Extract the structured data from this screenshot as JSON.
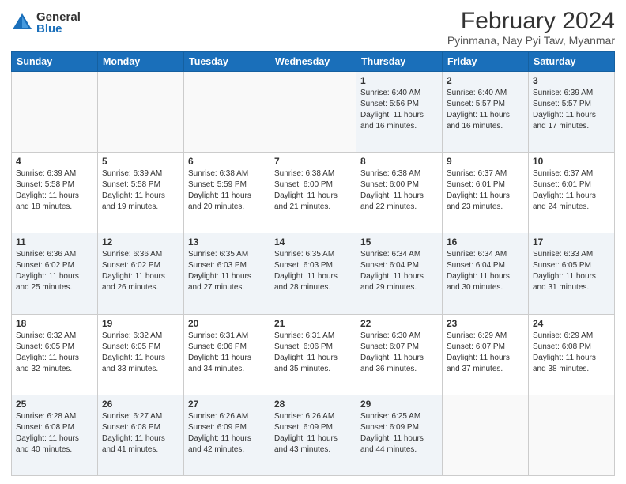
{
  "header": {
    "logo_general": "General",
    "logo_blue": "Blue",
    "title": "February 2024",
    "subtitle": "Pyinmana, Nay Pyi Taw, Myanmar"
  },
  "days_of_week": [
    "Sunday",
    "Monday",
    "Tuesday",
    "Wednesday",
    "Thursday",
    "Friday",
    "Saturday"
  ],
  "weeks": [
    [
      {
        "day": "",
        "info": ""
      },
      {
        "day": "",
        "info": ""
      },
      {
        "day": "",
        "info": ""
      },
      {
        "day": "",
        "info": ""
      },
      {
        "day": "1",
        "info": "Sunrise: 6:40 AM\nSunset: 5:56 PM\nDaylight: 11 hours\nand 16 minutes."
      },
      {
        "day": "2",
        "info": "Sunrise: 6:40 AM\nSunset: 5:57 PM\nDaylight: 11 hours\nand 16 minutes."
      },
      {
        "day": "3",
        "info": "Sunrise: 6:39 AM\nSunset: 5:57 PM\nDaylight: 11 hours\nand 17 minutes."
      }
    ],
    [
      {
        "day": "4",
        "info": "Sunrise: 6:39 AM\nSunset: 5:58 PM\nDaylight: 11 hours\nand 18 minutes."
      },
      {
        "day": "5",
        "info": "Sunrise: 6:39 AM\nSunset: 5:58 PM\nDaylight: 11 hours\nand 19 minutes."
      },
      {
        "day": "6",
        "info": "Sunrise: 6:38 AM\nSunset: 5:59 PM\nDaylight: 11 hours\nand 20 minutes."
      },
      {
        "day": "7",
        "info": "Sunrise: 6:38 AM\nSunset: 6:00 PM\nDaylight: 11 hours\nand 21 minutes."
      },
      {
        "day": "8",
        "info": "Sunrise: 6:38 AM\nSunset: 6:00 PM\nDaylight: 11 hours\nand 22 minutes."
      },
      {
        "day": "9",
        "info": "Sunrise: 6:37 AM\nSunset: 6:01 PM\nDaylight: 11 hours\nand 23 minutes."
      },
      {
        "day": "10",
        "info": "Sunrise: 6:37 AM\nSunset: 6:01 PM\nDaylight: 11 hours\nand 24 minutes."
      }
    ],
    [
      {
        "day": "11",
        "info": "Sunrise: 6:36 AM\nSunset: 6:02 PM\nDaylight: 11 hours\nand 25 minutes."
      },
      {
        "day": "12",
        "info": "Sunrise: 6:36 AM\nSunset: 6:02 PM\nDaylight: 11 hours\nand 26 minutes."
      },
      {
        "day": "13",
        "info": "Sunrise: 6:35 AM\nSunset: 6:03 PM\nDaylight: 11 hours\nand 27 minutes."
      },
      {
        "day": "14",
        "info": "Sunrise: 6:35 AM\nSunset: 6:03 PM\nDaylight: 11 hours\nand 28 minutes."
      },
      {
        "day": "15",
        "info": "Sunrise: 6:34 AM\nSunset: 6:04 PM\nDaylight: 11 hours\nand 29 minutes."
      },
      {
        "day": "16",
        "info": "Sunrise: 6:34 AM\nSunset: 6:04 PM\nDaylight: 11 hours\nand 30 minutes."
      },
      {
        "day": "17",
        "info": "Sunrise: 6:33 AM\nSunset: 6:05 PM\nDaylight: 11 hours\nand 31 minutes."
      }
    ],
    [
      {
        "day": "18",
        "info": "Sunrise: 6:32 AM\nSunset: 6:05 PM\nDaylight: 11 hours\nand 32 minutes."
      },
      {
        "day": "19",
        "info": "Sunrise: 6:32 AM\nSunset: 6:05 PM\nDaylight: 11 hours\nand 33 minutes."
      },
      {
        "day": "20",
        "info": "Sunrise: 6:31 AM\nSunset: 6:06 PM\nDaylight: 11 hours\nand 34 minutes."
      },
      {
        "day": "21",
        "info": "Sunrise: 6:31 AM\nSunset: 6:06 PM\nDaylight: 11 hours\nand 35 minutes."
      },
      {
        "day": "22",
        "info": "Sunrise: 6:30 AM\nSunset: 6:07 PM\nDaylight: 11 hours\nand 36 minutes."
      },
      {
        "day": "23",
        "info": "Sunrise: 6:29 AM\nSunset: 6:07 PM\nDaylight: 11 hours\nand 37 minutes."
      },
      {
        "day": "24",
        "info": "Sunrise: 6:29 AM\nSunset: 6:08 PM\nDaylight: 11 hours\nand 38 minutes."
      }
    ],
    [
      {
        "day": "25",
        "info": "Sunrise: 6:28 AM\nSunset: 6:08 PM\nDaylight: 11 hours\nand 40 minutes."
      },
      {
        "day": "26",
        "info": "Sunrise: 6:27 AM\nSunset: 6:08 PM\nDaylight: 11 hours\nand 41 minutes."
      },
      {
        "day": "27",
        "info": "Sunrise: 6:26 AM\nSunset: 6:09 PM\nDaylight: 11 hours\nand 42 minutes."
      },
      {
        "day": "28",
        "info": "Sunrise: 6:26 AM\nSunset: 6:09 PM\nDaylight: 11 hours\nand 43 minutes."
      },
      {
        "day": "29",
        "info": "Sunrise: 6:25 AM\nSunset: 6:09 PM\nDaylight: 11 hours\nand 44 minutes."
      },
      {
        "day": "",
        "info": ""
      },
      {
        "day": "",
        "info": ""
      }
    ]
  ]
}
